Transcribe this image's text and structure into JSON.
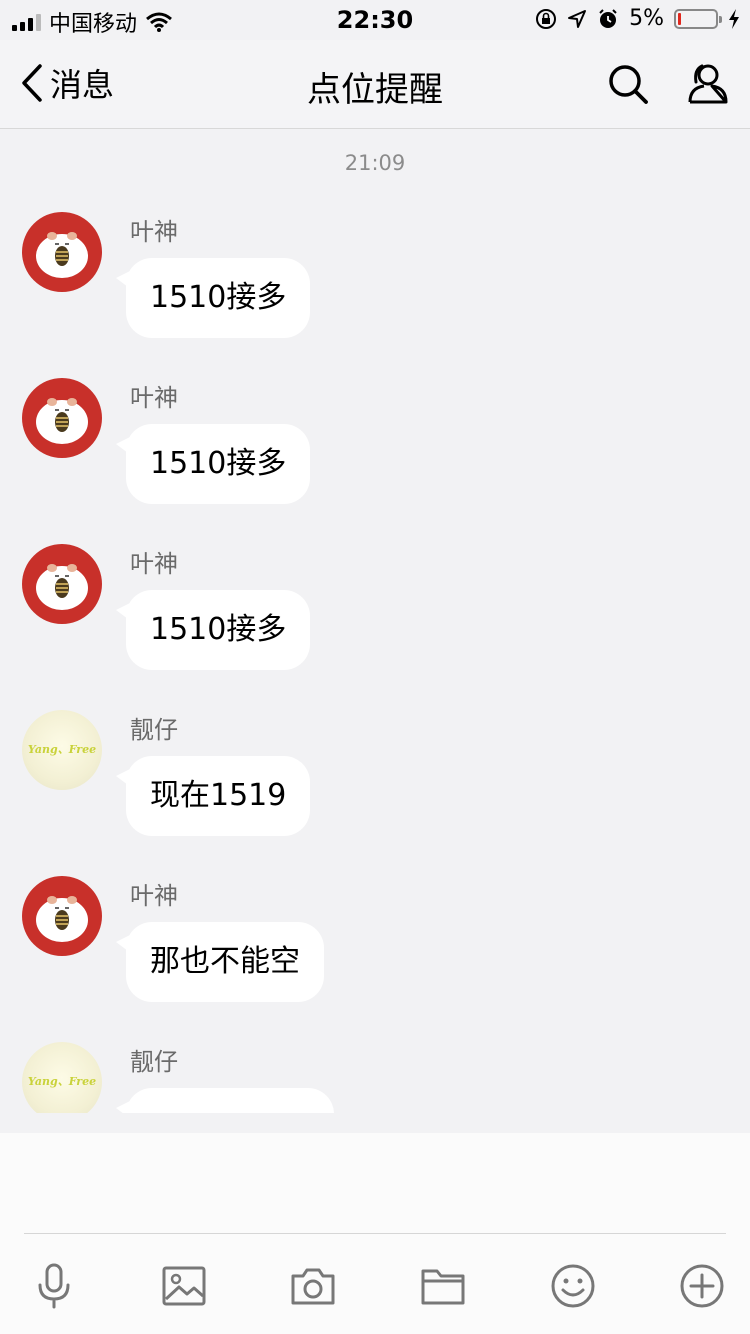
{
  "status": {
    "carrier": "中国移动",
    "time": "22:30",
    "battery": "5%",
    "icons": [
      "signal-icon",
      "wifi-icon",
      "orientation-lock-icon",
      "location-icon",
      "alarm-icon",
      "charging-icon"
    ]
  },
  "nav": {
    "back_label": "消息",
    "title": "点位提醒",
    "icons": [
      "back-chevron-icon",
      "search-icon",
      "group-members-icon"
    ]
  },
  "chat": {
    "timestamp": "21:09",
    "messages": [
      {
        "sender": "叶神",
        "text": "1510接多",
        "avatar": "hamster-avatar"
      },
      {
        "sender": "叶神",
        "text": "1510接多",
        "avatar": "hamster-avatar"
      },
      {
        "sender": "叶神",
        "text": "1510接多",
        "avatar": "hamster-avatar"
      },
      {
        "sender": "靓仔",
        "text": "现在1519",
        "avatar": "yang-free-avatar",
        "avatar_text": "Yang、Free"
      },
      {
        "sender": "叶神",
        "text": "那也不能空",
        "avatar": "hamster-avatar"
      },
      {
        "sender": "靓仔",
        "text": "",
        "avatar": "yang-free-avatar",
        "avatar_text": "Yang、Free"
      }
    ]
  },
  "toolbar": {
    "icons": [
      "microphone-icon",
      "image-icon",
      "camera-icon",
      "folder-icon",
      "emoji-icon",
      "plus-icon"
    ]
  },
  "colors": {
    "background": "#f2f2f4",
    "bubble": "#ffffff",
    "avatar_red": "#c8302a",
    "battery_low": "#e0281e",
    "secondary_text": "#8b8b8b"
  }
}
